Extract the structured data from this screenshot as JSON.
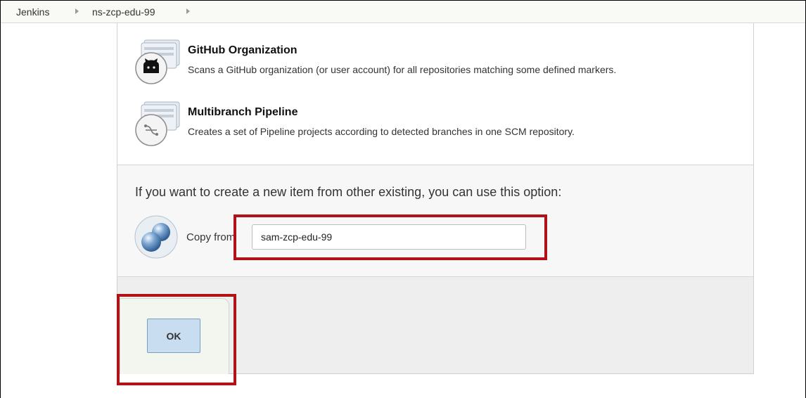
{
  "breadcrumb": {
    "items": [
      "Jenkins",
      "ns-zcp-edu-99"
    ]
  },
  "item_types": [
    {
      "name": "GitHub Organization",
      "description": "Scans a GitHub organization (or user account) for all repositories matching some defined markers.",
      "icon": "github-octocat-icon"
    },
    {
      "name": "Multibranch Pipeline",
      "description": "Creates a set of Pipeline projects according to detected branches in one SCM repository.",
      "icon": "branch-icon"
    }
  ],
  "copy_section": {
    "hint": "If you want to create a new item from other existing, you can use this option:",
    "label": "Copy from",
    "value": "sam-zcp-edu-99",
    "icon": "copy-spheres-icon"
  },
  "footer": {
    "ok_label": "OK"
  },
  "colors": {
    "highlight": "#b01218",
    "ok_button": "#c9ddf1"
  }
}
